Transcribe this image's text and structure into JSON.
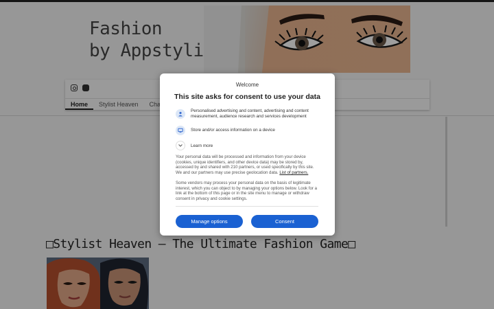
{
  "site": {
    "title_line1": "Fashion",
    "title_line2": "by Appstylist",
    "nav": [
      "Home",
      "Stylist Heaven",
      "Cha"
    ],
    "post_title": "□Stylist Heaven – The Ultimate Fashion Game□",
    "social_icons": [
      "instagram-icon",
      "facebook-icon"
    ]
  },
  "dialog": {
    "welcome": "Welcome",
    "title": "This site asks for consent to use your data",
    "purposes": [
      {
        "icon": "person-icon",
        "text": "Personalised advertising and content, advertising and content measurement, audience research and services development"
      },
      {
        "icon": "device-icon",
        "text": "Store and/or access information on a device"
      }
    ],
    "learn_more": "Learn more",
    "paragraph1": "Your personal data will be processed and information from your device (cookies, unique identifiers, and other device data) may be stored by, accessed by and shared with 210 partners, or used specifically by this site. We and our partners may use precise geolocation data.",
    "partners_link": "List of partners.",
    "paragraph2": "Some vendors may process your personal data on the basis of legitimate interest, which you can object to by managing your options below. Look for a link at the bottom of this page or in the site menu to manage or withdraw consent in privacy and cookie settings.",
    "manage_label": "Manage options",
    "consent_label": "Consent"
  },
  "colors": {
    "primary_button": "#1a61d2",
    "overlay": "rgba(0,0,0,0.38)"
  }
}
